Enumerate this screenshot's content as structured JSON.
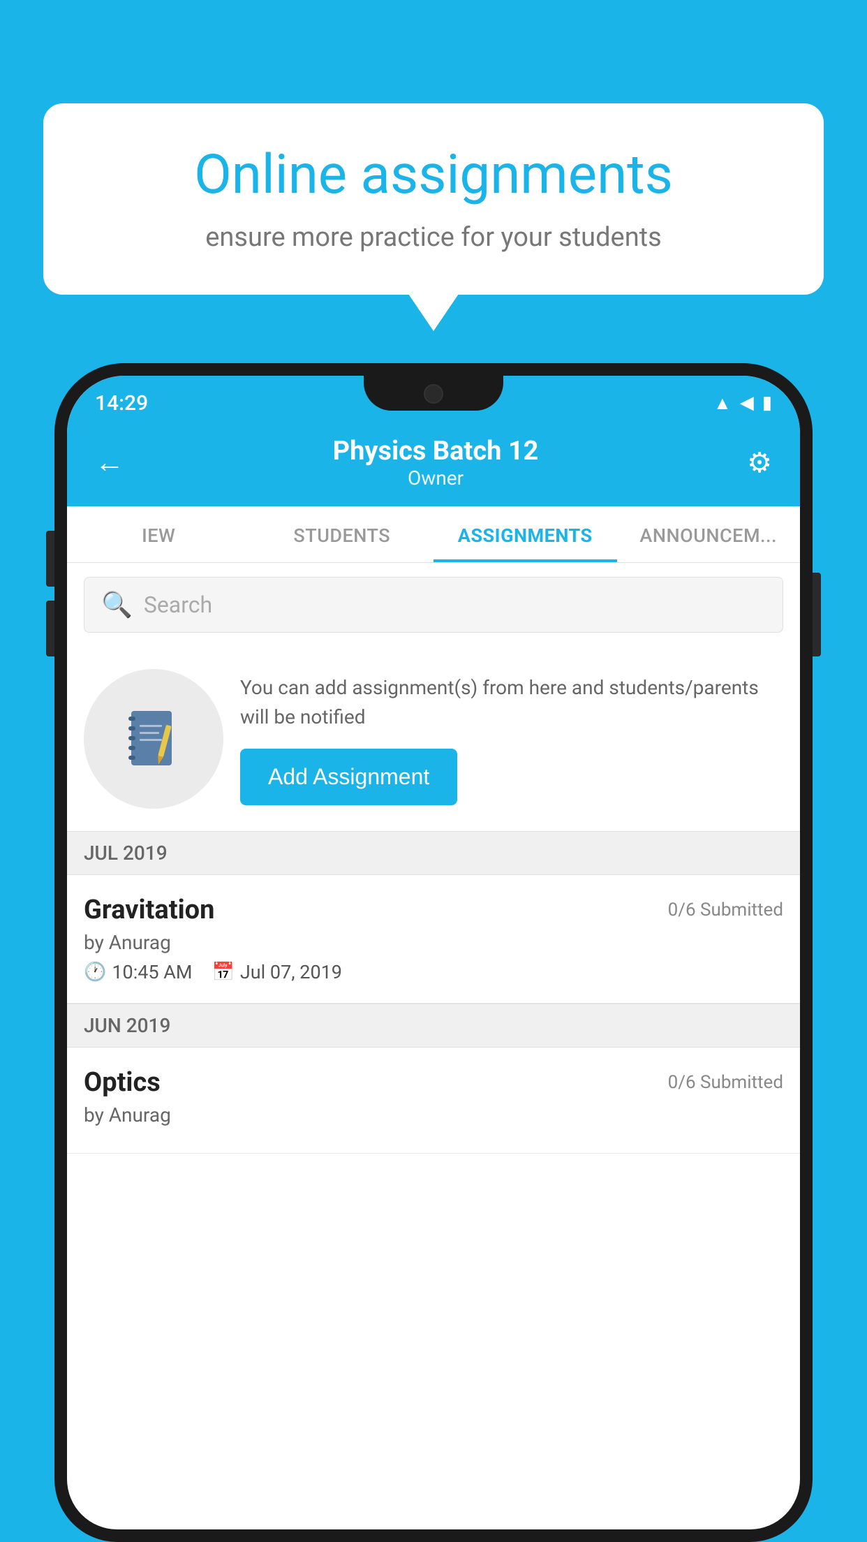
{
  "background_color": "#1ab4e8",
  "speech_bubble": {
    "title": "Online assignments",
    "subtitle": "ensure more practice for your students"
  },
  "status_bar": {
    "time": "14:29",
    "icons": [
      "wifi",
      "signal",
      "battery"
    ]
  },
  "header": {
    "title": "Physics Batch 12",
    "subtitle": "Owner",
    "back_label": "←",
    "settings_label": "⚙"
  },
  "tabs": [
    {
      "label": "IEW",
      "active": false
    },
    {
      "label": "STUDENTS",
      "active": false
    },
    {
      "label": "ASSIGNMENTS",
      "active": true
    },
    {
      "label": "ANNOUNCEM...",
      "active": false
    }
  ],
  "search": {
    "placeholder": "Search"
  },
  "add_assignment_area": {
    "description": "You can add assignment(s) from here and students/parents will be notified",
    "button_label": "Add Assignment"
  },
  "sections": [
    {
      "label": "JUL 2019",
      "assignments": [
        {
          "name": "Gravitation",
          "submitted": "0/6 Submitted",
          "by": "by Anurag",
          "time": "10:45 AM",
          "date": "Jul 07, 2019"
        }
      ]
    },
    {
      "label": "JUN 2019",
      "assignments": [
        {
          "name": "Optics",
          "submitted": "0/6 Submitted",
          "by": "by Anurag",
          "time": "",
          "date": ""
        }
      ]
    }
  ]
}
